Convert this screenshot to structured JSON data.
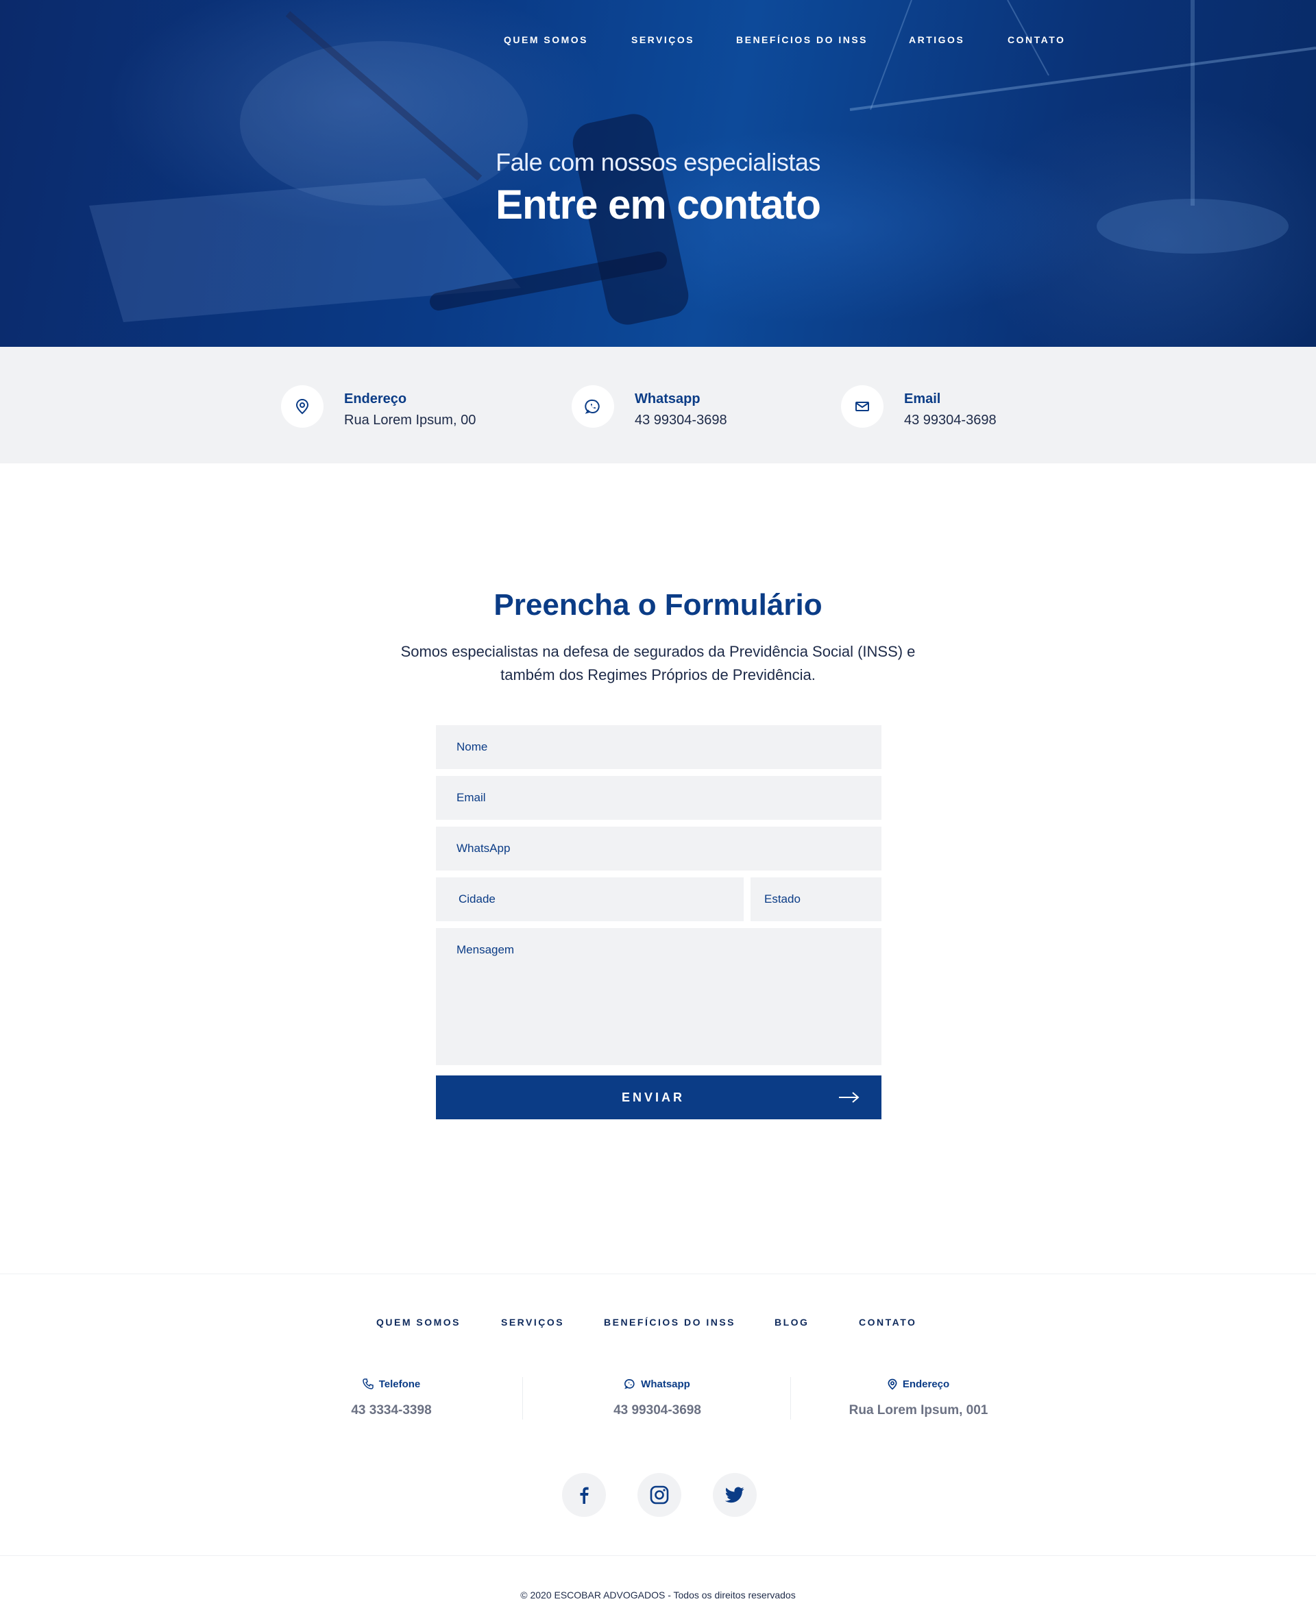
{
  "nav": {
    "items": [
      {
        "label": "QUEM SOMOS"
      },
      {
        "label": "SERVIÇOS"
      },
      {
        "label": "BENEFÍCIOS DO INSS"
      },
      {
        "label": "ARTIGOS"
      },
      {
        "label": "CONTATO"
      }
    ]
  },
  "hero": {
    "subtitle": "Fale com nossos especialistas",
    "title": "Entre em contato"
  },
  "contact_strip": {
    "address": {
      "label": "Endereço",
      "value": "Rua Lorem Ipsum, 00",
      "icon": "map-pin-icon"
    },
    "whatsapp": {
      "label": "Whatsapp",
      "value": "43 99304-3698",
      "icon": "whatsapp-icon"
    },
    "email": {
      "label": "Email",
      "value": "43 99304-3698",
      "icon": "mail-icon"
    }
  },
  "form": {
    "title": "Preencha o Formulário",
    "description": "Somos especialistas na defesa de segurados da Previdência Social (INSS) e também dos Regimes Próprios de Previdência.",
    "name_placeholder": "Nome",
    "email_placeholder": "Email",
    "whatsapp_placeholder": "WhatsApp",
    "city_placeholder": "Cidade",
    "state_placeholder": "Estado",
    "message_placeholder": "Mensagem",
    "submit_label": "ENVIAR"
  },
  "footer": {
    "nav": [
      {
        "label": "QUEM SOMOS"
      },
      {
        "label": "SERVIÇOS"
      },
      {
        "label": "BENEFÍCIOS DO INSS"
      },
      {
        "label": "BLOG"
      },
      {
        "label": "CONTATO"
      }
    ],
    "phone": {
      "label": "Telefone",
      "value": "43 3334-3398",
      "icon": "phone-icon"
    },
    "whatsapp": {
      "label": "Whatsapp",
      "value": "43 99304-3698",
      "icon": "whatsapp-icon"
    },
    "address": {
      "label": "Endereço",
      "value": "Rua Lorem Ipsum, 001",
      "icon": "map-pin-icon"
    },
    "social": [
      "facebook-icon",
      "instagram-icon",
      "twitter-icon"
    ],
    "copyright": "© 2020 ESCOBAR ADVOGADOS - Todos os direitos reservados"
  },
  "colors": {
    "brand": "#0b3c86",
    "hero_bg": "#0a3a86",
    "light_bg": "#f1f2f4",
    "text_muted": "#6b7183"
  }
}
